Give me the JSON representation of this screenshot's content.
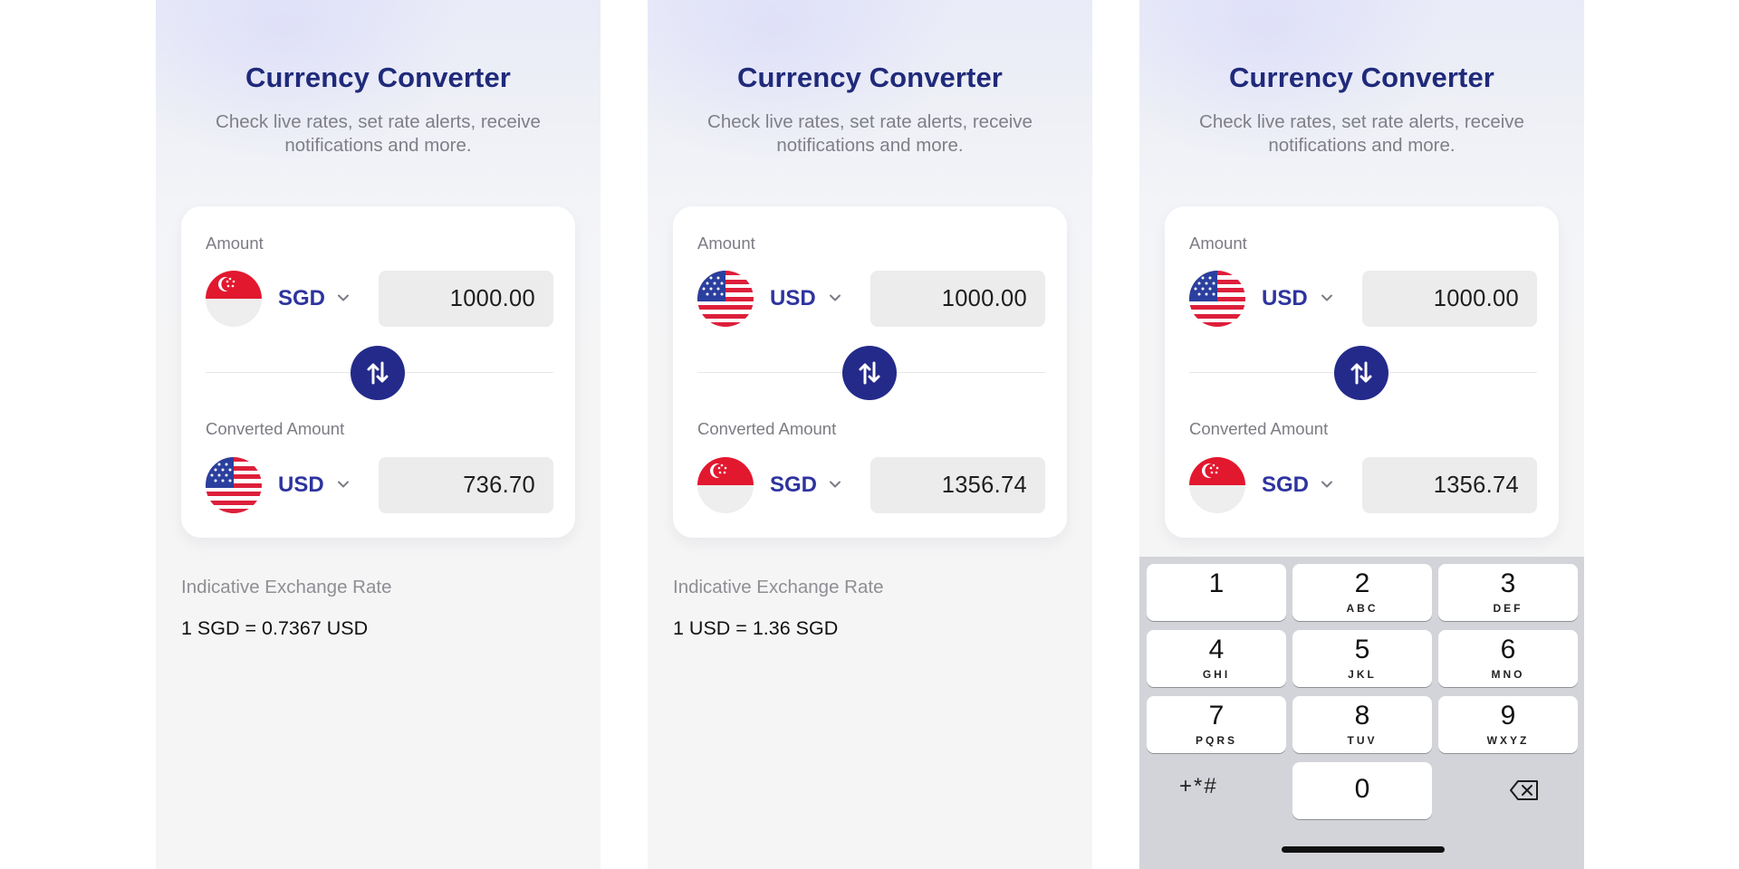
{
  "screens": [
    {
      "title": "Currency Converter",
      "subtitle": "Check live rates, set rate alerts, receive notifications and more.",
      "amount_label": "Amount",
      "from_currency": "SGD",
      "from_flag": "singapore-flag-icon",
      "amount_value": "1000.00",
      "converted_label": "Converted Amount",
      "to_currency": "USD",
      "to_flag": "usa-flag-icon",
      "converted_value": "736.70",
      "rate_label": "Indicative Exchange Rate",
      "rate_value": "1 SGD = 0.7367 USD"
    },
    {
      "title": "Currency Converter",
      "subtitle": "Check live rates, set rate alerts, receive notifications and more.",
      "amount_label": "Amount",
      "from_currency": "USD",
      "from_flag": "usa-flag-icon",
      "amount_value": "1000.00",
      "converted_label": "Converted Amount",
      "to_currency": "SGD",
      "to_flag": "singapore-flag-icon",
      "converted_value": "1356.74",
      "rate_label": "Indicative Exchange Rate",
      "rate_value": "1 USD = 1.36 SGD"
    },
    {
      "title": "Currency Converter",
      "subtitle": "Check live rates, set rate alerts, receive notifications and more.",
      "amount_label": "Amount",
      "from_currency": "USD",
      "from_flag": "usa-flag-icon",
      "amount_value": "1000.00",
      "converted_label": "Converted Amount",
      "to_currency": "SGD",
      "to_flag": "singapore-flag-icon",
      "converted_value": "1356.74"
    }
  ],
  "keyboard": {
    "keys": [
      {
        "num": "1",
        "letters": ""
      },
      {
        "num": "2",
        "letters": "ABC"
      },
      {
        "num": "3",
        "letters": "DEF"
      },
      {
        "num": "4",
        "letters": "GHI"
      },
      {
        "num": "5",
        "letters": "JKL"
      },
      {
        "num": "6",
        "letters": "MNO"
      },
      {
        "num": "7",
        "letters": "PQRS"
      },
      {
        "num": "8",
        "letters": "TUV"
      },
      {
        "num": "9",
        "letters": "WXYZ"
      },
      {
        "num": "0",
        "letters": ""
      }
    ],
    "symbols": "+*#",
    "delete_icon": "backspace-icon"
  },
  "colors": {
    "title": "#1f2a7a",
    "accent": "#242a8a",
    "currency_code": "#2e349e",
    "value_box": "#ececec"
  },
  "icons": {
    "swap": "swap-arrows-icon",
    "dropdown": "chevron-down-icon"
  }
}
